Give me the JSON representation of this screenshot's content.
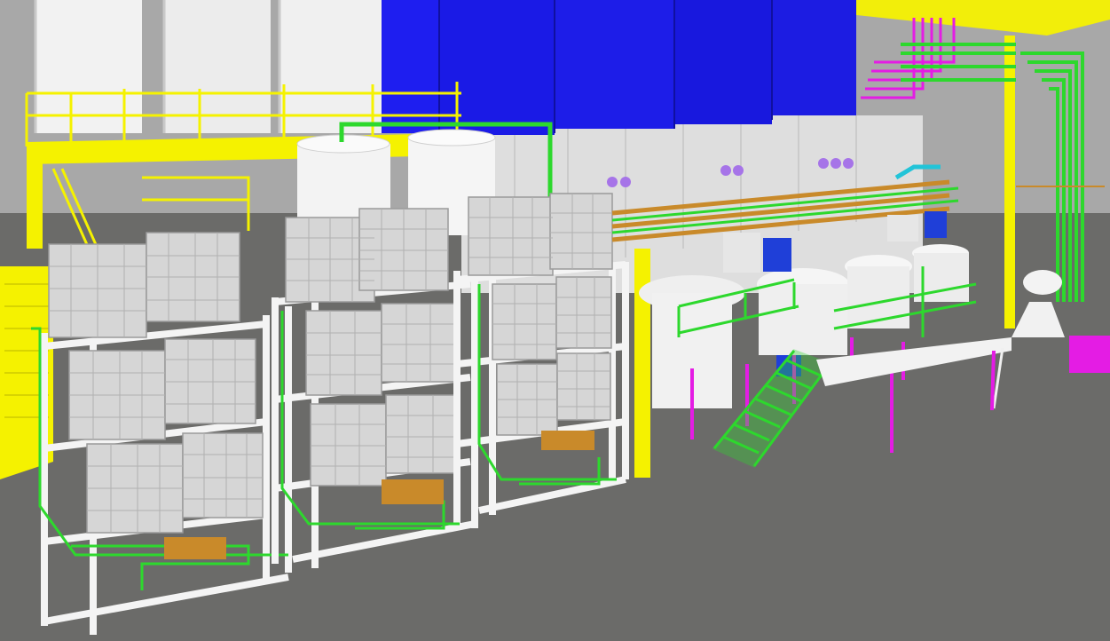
{
  "viewer": {
    "colors": {
      "floor": "#6b6b69",
      "back_wall": "#a7a7a7",
      "wall_panel": "#dcdcdc",
      "ceiling_beam": "#f2ee0a",
      "steel_yellow": "#f5f200",
      "pipe_green": "#2dd82d",
      "pipe_magenta": "#e41ce4",
      "pipe_orange": "#c98a2a",
      "tank_white": "#f1f1f1",
      "tank_blue": "#1e1ee6",
      "ibc_grey": "#d4d4d4",
      "rack_white": "#f4f4f4",
      "valve_purple": "#a674e8",
      "motor_blue": "#1f3fd8",
      "cyan_pipe": "#22c4d8"
    }
  }
}
